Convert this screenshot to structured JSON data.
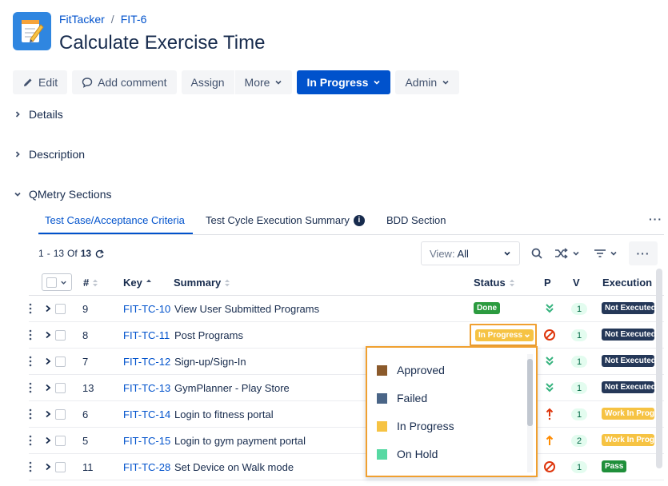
{
  "breadcrumb": {
    "project": "FitTacker",
    "separator": "/",
    "issue": "FIT-6"
  },
  "issue_title": "Calculate Exercise Time",
  "toolbar": {
    "edit": "Edit",
    "add_comment": "Add comment",
    "assign": "Assign",
    "more": "More",
    "status": "In Progress",
    "admin": "Admin"
  },
  "sections": {
    "details": "Details",
    "description": "Description",
    "qmetry": "QMetry Sections"
  },
  "tabs": [
    {
      "label": "Test Case/Acceptance Criteria"
    },
    {
      "label": "Test Cycle Execution Summary"
    },
    {
      "label": "BDD Section"
    }
  ],
  "pager": {
    "start": "1",
    "dash": "-",
    "end": "13",
    "of": "Of",
    "total": "13"
  },
  "view_select": {
    "label": "View",
    "colon": ":",
    "value": "All"
  },
  "columns": {
    "num": "#",
    "key": "Key",
    "summary": "Summary",
    "status": "Status",
    "priority": "P",
    "version": "V",
    "execution": "Execution R"
  },
  "rows": [
    {
      "num": "9",
      "key": "FIT-TC-10",
      "summary": "View User Submitted Programs",
      "status": "Done",
      "version": "1",
      "execution": "Not Executed"
    },
    {
      "num": "8",
      "key": "FIT-TC-11",
      "summary": "Post Programs",
      "status": "In Progress",
      "version": "1",
      "execution": "Not Executed"
    },
    {
      "num": "7",
      "key": "FIT-TC-12",
      "summary": "Sign-up/Sign-In",
      "status": "",
      "version": "1",
      "execution": "Not Executed"
    },
    {
      "num": "13",
      "key": "FIT-TC-13",
      "summary": "GymPlanner - Play Store",
      "status": "",
      "version": "1",
      "execution": "Not Executed"
    },
    {
      "num": "6",
      "key": "FIT-TC-14",
      "summary": "Login to fitness portal",
      "status": "",
      "version": "1",
      "execution": "Work In Progress"
    },
    {
      "num": "5",
      "key": "FIT-TC-15",
      "summary": "Login to gym payment portal",
      "status": "",
      "version": "2",
      "execution": "Work In Progress"
    },
    {
      "num": "11",
      "key": "FIT-TC-28",
      "summary": "Set Device on Walk mode",
      "status": "",
      "version": "1",
      "execution": "Pass"
    }
  ],
  "dropdown_options": [
    {
      "label": "Approved",
      "color": "#8b5a2b"
    },
    {
      "label": "Failed",
      "color": "#4a6587"
    },
    {
      "label": "In Progress",
      "color": "#f6c343"
    },
    {
      "label": "On Hold",
      "color": "#57d9a3"
    }
  ],
  "colors": {
    "primary": "#0052cc",
    "highlight": "#f0a030"
  }
}
